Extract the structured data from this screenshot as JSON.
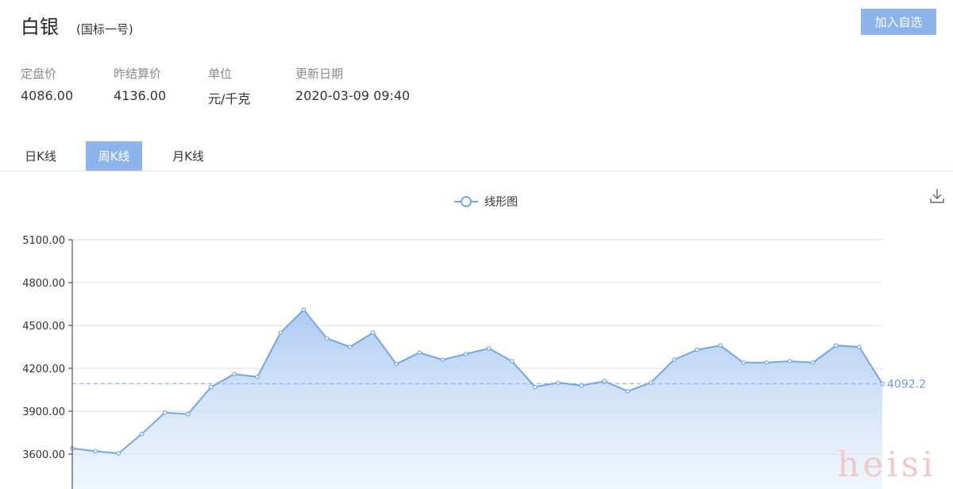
{
  "header": {
    "title": "白银",
    "subtitle": "(国标一号)",
    "add_button": "加入自选"
  },
  "stats": [
    {
      "label": "定盘价",
      "value": "4086.00"
    },
    {
      "label": "昨结算价",
      "value": "4136.00"
    },
    {
      "label": "单位",
      "value": "元/千克"
    },
    {
      "label": "更新日期",
      "value": "2020-03-09 09:40"
    }
  ],
  "tabs": [
    {
      "label": "日K线",
      "active": false
    },
    {
      "label": "周K线",
      "active": true
    },
    {
      "label": "月K线",
      "active": false
    }
  ],
  "icons": {
    "download": "download-icon"
  },
  "colors": {
    "accent": "#8cb4ea",
    "line": "#74a6e6",
    "area_top": "#a9c8f2",
    "axis": "#333333"
  },
  "watermark": "heisi",
  "chart_data": {
    "type": "area",
    "legend": "线形图",
    "legend_position": "top-center",
    "ylim": [
      3450,
      5100
    ],
    "yticks": [
      "3600.00",
      "3900.00",
      "4200.00",
      "4500.00",
      "4800.00",
      "5100.00"
    ],
    "grid": true,
    "values": [
      3640,
      3620,
      3605,
      3740,
      3890,
      3880,
      4070,
      4160,
      4140,
      4450,
      4610,
      4410,
      4350,
      4450,
      4230,
      4310,
      4260,
      4300,
      4340,
      4250,
      4070,
      4100,
      4080,
      4110,
      4040,
      4100,
      4260,
      4330,
      4360,
      4240,
      4240,
      4250,
      4240,
      4360,
      4350,
      4092.2
    ],
    "markline": {
      "value": 4092.2,
      "label": "4092.2"
    }
  }
}
